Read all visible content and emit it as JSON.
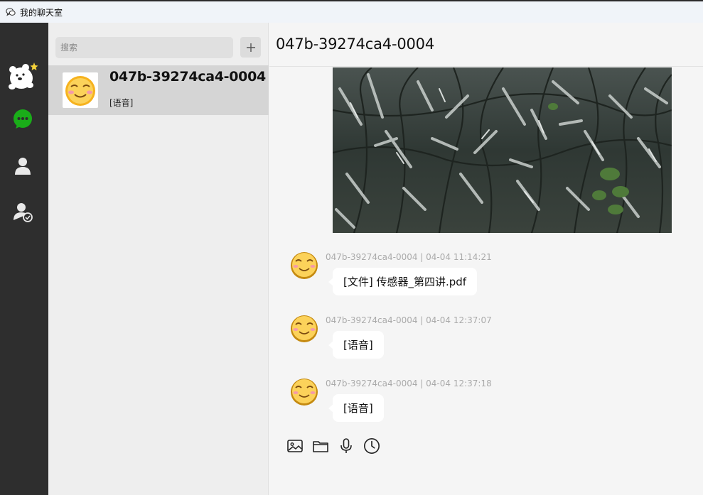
{
  "window": {
    "title": "我的聊天室",
    "app_icon": "chat-bubbles-icon"
  },
  "leftbar": {
    "items": [
      {
        "name": "logo",
        "icon": "bear-mascot-icon",
        "active": false
      },
      {
        "name": "chat",
        "icon": "chat-icon",
        "active": true,
        "color": "#1aad19"
      },
      {
        "name": "contacts",
        "icon": "person-icon",
        "active": false
      },
      {
        "name": "friend-requests",
        "icon": "person-check-icon",
        "active": false
      }
    ]
  },
  "search": {
    "placeholder": "搜索",
    "value": ""
  },
  "add_button": {
    "icon": "plus-icon"
  },
  "conversations": [
    {
      "name": "047b-39274ca4-0004",
      "preview": "[语音]",
      "selected": true
    }
  ],
  "chat": {
    "title": "047b-39274ca4-0004",
    "messages": [
      {
        "type": "image",
        "description_icon": "photo"
      },
      {
        "type": "file",
        "meta": "047b-39274ca4-0004 | 04-04 11:14:21",
        "text": "[文件] 传感器_第四讲.pdf"
      },
      {
        "type": "voice",
        "meta": "047b-39274ca4-0004 | 04-04 12:37:07",
        "text": "[语音]"
      },
      {
        "type": "voice",
        "meta": "047b-39274ca4-0004 | 04-04 12:37:18",
        "text": "[语音]"
      }
    ]
  },
  "toolbar": {
    "items": [
      {
        "name": "send-image",
        "icon": "image-icon"
      },
      {
        "name": "send-file",
        "icon": "folder-icon"
      },
      {
        "name": "send-voice",
        "icon": "microphone-icon"
      },
      {
        "name": "history",
        "icon": "clock-icon"
      }
    ]
  },
  "colors": {
    "sidebar": "#2e2e2e",
    "active_green": "#1aad19",
    "selected_row": "#d5d5d5",
    "bubble": "#ffffff"
  }
}
